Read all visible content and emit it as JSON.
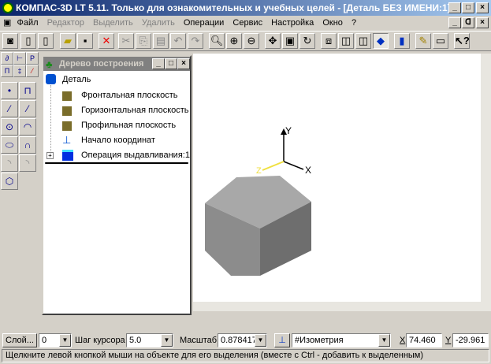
{
  "window": {
    "title": "КОМПАС-3D LT 5.11. Только для ознакомительных и учебных целей - [Деталь БЕЗ ИМЕНИ:1]"
  },
  "menu": [
    {
      "label": "Файл",
      "enabled": true
    },
    {
      "label": "Редактор",
      "enabled": false
    },
    {
      "label": "Выделить",
      "enabled": false
    },
    {
      "label": "Удалить",
      "enabled": false
    },
    {
      "label": "Операции",
      "enabled": true
    },
    {
      "label": "Сервис",
      "enabled": true
    },
    {
      "label": "Настройка",
      "enabled": true
    },
    {
      "label": "Окно",
      "enabled": true
    },
    {
      "label": "?",
      "enabled": true
    }
  ],
  "tree": {
    "title": "Дерево построения",
    "root": "Деталь",
    "items": [
      "Фронтальная плоскость",
      "Горизонтальная плоскость",
      "Профильная плоскость",
      "Начало координат",
      "Операция выдавливания:1"
    ]
  },
  "axes": {
    "x": "X",
    "y": "Y",
    "z": "Z"
  },
  "bottom": {
    "layer_btn": "Слой...",
    "layer": "0",
    "step_label": "Шаг курсора",
    "step": "5.0",
    "scale_label": "Масштаб",
    "scale": "0.878417",
    "view": "#Изометрия",
    "x_label": "X",
    "x": "74.460",
    "y_label": "Y",
    "y": "-29.961"
  },
  "status": "Щелкните левой кнопкой мыши на объекте для его выделения (вместе с Ctrl - добавить к выделенным)"
}
